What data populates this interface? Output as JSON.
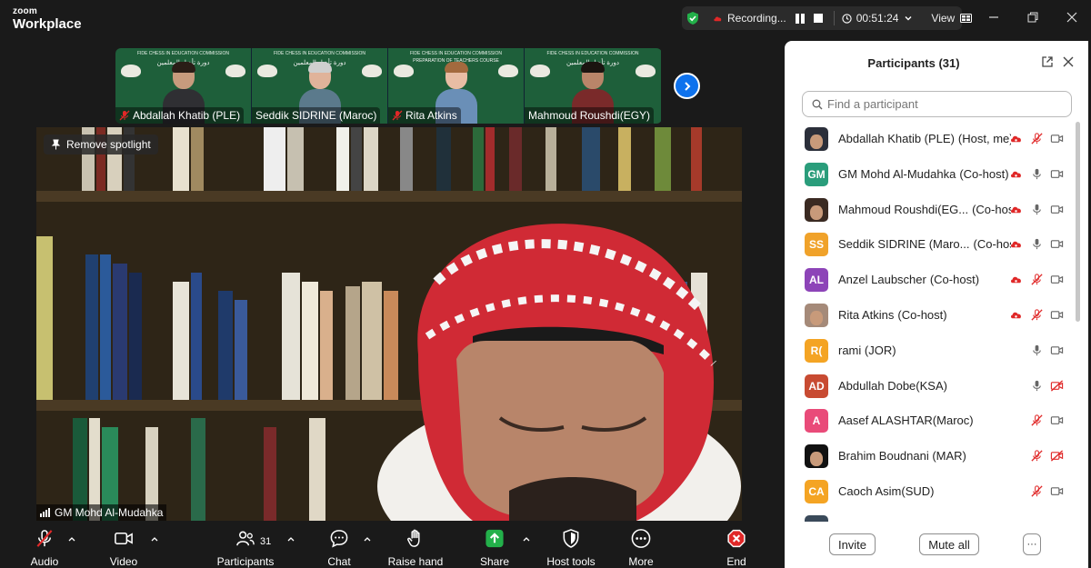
{
  "app": {
    "brand_top": "zoom",
    "brand_bottom": "Workplace"
  },
  "topbar": {
    "recording_label": "Recording...",
    "timer": "00:51:24",
    "view_label": "View",
    "status_color": "#23b04a",
    "record_color": "#e02828"
  },
  "thumbnails": [
    {
      "header": "FIDE CHESS IN EDUCATION COMMISSION",
      "arabic": "دورة تأهيل المعلمين",
      "name": "Abdallah Khatib (PLE)",
      "muted": true
    },
    {
      "header": "FIDE CHESS IN EDUCATION COMMISSION",
      "arabic": "دورة تأهيل المعلمين",
      "name": "Seddik SIDRINE (Maroc)",
      "muted": false
    },
    {
      "header": "FIDE CHESS IN EDUCATION COMMISSION",
      "subheader": "PREPARATION OF TEACHERS COURSE",
      "arabic": "",
      "name": "Rita Atkins",
      "muted": true
    },
    {
      "header": "FIDE CHESS IN EDUCATION COMMISSION",
      "arabic": "دورة تأهيل المعلمين",
      "name": "Mahmoud Roushdi(EGY)",
      "muted": false
    }
  ],
  "main_video": {
    "spotlight_label": "Remove spotlight",
    "speaker_name": "GM Mohd Al-Mudahka"
  },
  "panel": {
    "title": "Participants (31)",
    "search_placeholder": "Find a participant",
    "invite_label": "Invite",
    "mute_all_label": "Mute all",
    "more_label": "···",
    "participants": [
      {
        "name": "Abdallah Khatib (PLE)",
        "role": "(Host, me)",
        "initials": "",
        "avatar_color": "#2b2f3a",
        "recording": true,
        "mic": "muted",
        "cam": "on"
      },
      {
        "name": "GM Mohd Al-Mudahka",
        "role": "(Co-host)",
        "initials": "GM",
        "avatar_color": "#2a9d7b",
        "recording": true,
        "mic": "on",
        "cam": "on"
      },
      {
        "name": "Mahmoud Roushdi(EG...",
        "role": "(Co-host)",
        "initials": "",
        "avatar_color": "#3a2a22",
        "recording": true,
        "mic": "on",
        "cam": "on"
      },
      {
        "name": "Seddik SIDRINE (Maro...",
        "role": "(Co-host)",
        "initials": "SS",
        "avatar_color": "#f0a22a",
        "recording": true,
        "mic": "on",
        "cam": "on"
      },
      {
        "name": "Anzel Laubscher",
        "role": "(Co-host)",
        "initials": "AL",
        "avatar_color": "#8d44b8",
        "recording": true,
        "mic": "muted",
        "cam": "on"
      },
      {
        "name": "Rita Atkins",
        "role": "(Co-host)",
        "initials": "",
        "avatar_color": "#a58a79",
        "recording": true,
        "mic": "muted",
        "cam": "on"
      },
      {
        "name": "rami (JOR)",
        "role": "",
        "initials": "R(",
        "avatar_color": "#f4a424",
        "recording": false,
        "mic": "on",
        "cam": "on"
      },
      {
        "name": "Abdullah Dobe(KSA)",
        "role": "",
        "initials": "AD",
        "avatar_color": "#c84b32",
        "recording": false,
        "mic": "on",
        "cam": "off"
      },
      {
        "name": "Aasef ALASHTAR(Maroc)",
        "role": "",
        "initials": "A",
        "avatar_color": "#e94b79",
        "recording": false,
        "mic": "muted",
        "cam": "on"
      },
      {
        "name": "Brahim Boudnani (MAR)",
        "role": "",
        "initials": "",
        "avatar_color": "#111111",
        "recording": false,
        "mic": "muted",
        "cam": "off"
      },
      {
        "name": "Caoch Asim(SUD)",
        "role": "",
        "initials": "CA",
        "avatar_color": "#f4a424",
        "recording": false,
        "mic": "muted",
        "cam": "on"
      }
    ]
  },
  "toolbar": {
    "audio": "Audio",
    "video": "Video",
    "participants": "Participants",
    "participants_count": "31",
    "chat": "Chat",
    "raise_hand": "Raise hand",
    "share": "Share",
    "host_tools": "Host tools",
    "more": "More",
    "end": "End",
    "share_color": "#23b04a",
    "end_color": "#e02828"
  }
}
